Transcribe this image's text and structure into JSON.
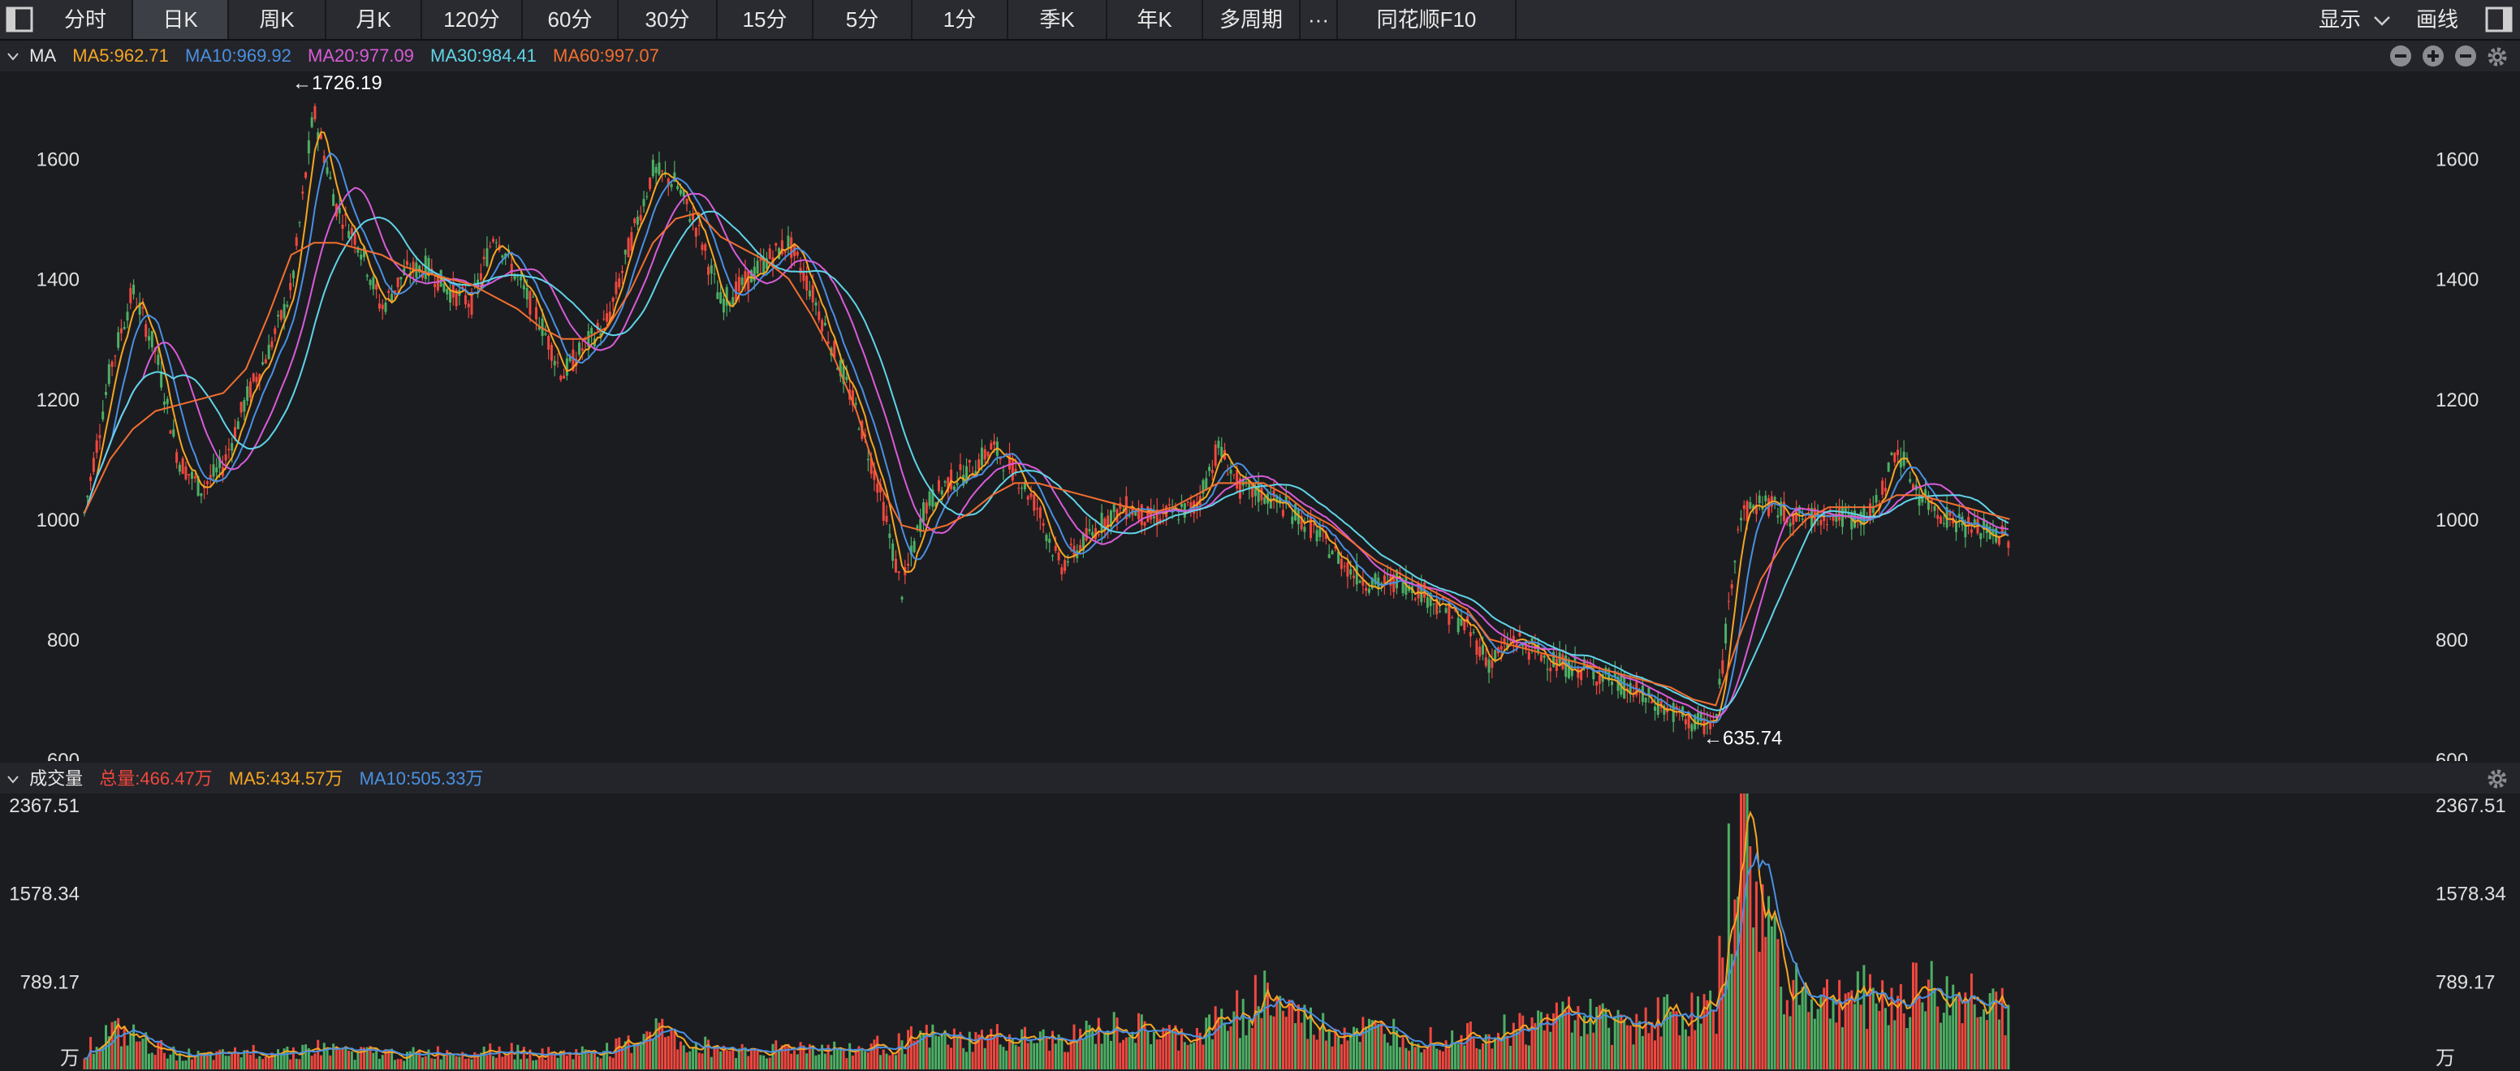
{
  "toolbar": {
    "tabs": [
      {
        "label": "分时"
      },
      {
        "label": "日K"
      },
      {
        "label": "周K"
      },
      {
        "label": "月K"
      },
      {
        "label": "120分"
      },
      {
        "label": "60分"
      },
      {
        "label": "30分"
      },
      {
        "label": "15分"
      },
      {
        "label": "5分"
      },
      {
        "label": "1分"
      },
      {
        "label": "季K"
      },
      {
        "label": "年K"
      },
      {
        "label": "多周期"
      },
      {
        "label": "···"
      },
      {
        "label": "同花顺F10"
      }
    ],
    "active_tab": "日K",
    "display_label": "显示",
    "draw_label": "画线"
  },
  "ma_legend": {
    "title": "MA",
    "ma5": "MA5:962.71",
    "ma10": "MA10:969.92",
    "ma20": "MA20:977.09",
    "ma30": "MA30:984.41",
    "ma60": "MA60:997.07"
  },
  "vol_legend": {
    "title": "成交量",
    "total": "总量:466.47万",
    "ma5": "MA5:434.57万",
    "ma10": "MA10:505.33万"
  },
  "colors": {
    "up": "#f0483e",
    "down": "#4caf64",
    "ma5": "#f5a623",
    "ma10": "#4a90e2",
    "ma20": "#d85cd8",
    "ma30": "#5fd4e8",
    "ma60": "#f26f30"
  },
  "chart_data": [
    {
      "type": "candlestick",
      "title": "",
      "y_ticks": [
        600,
        800,
        1000,
        1200,
        1400,
        1600
      ],
      "ylim": [
        600,
        1740
      ],
      "annotations": [
        {
          "label": "←1726.19",
          "value": 1726.19,
          "kind": "high"
        },
        {
          "label": "←635.74",
          "value": 635.74,
          "kind": "low"
        }
      ],
      "x": [
        0,
        16,
        30,
        44,
        58,
        72,
        86,
        100,
        114,
        128,
        142,
        156,
        170,
        184,
        198,
        212,
        226,
        240,
        254,
        268,
        282,
        296,
        310,
        324,
        338,
        352,
        366,
        380,
        394,
        408,
        422,
        436,
        450,
        464,
        478,
        492,
        506,
        520,
        534,
        548,
        562,
        576,
        590,
        604,
        618,
        632,
        646,
        660,
        674,
        688,
        702,
        716,
        730,
        744,
        758,
        772,
        786,
        800,
        814,
        828,
        842,
        856,
        870,
        884,
        898,
        912,
        926,
        940,
        954,
        968,
        982,
        996,
        1010,
        1024,
        1038,
        1052,
        1066,
        1080,
        1094,
        1108,
        1122,
        1136,
        1150,
        1164,
        1178,
        1192,
        1206,
        1220,
        1234,
        1248,
        1262,
        1276,
        1290,
        1304,
        1318,
        1332
      ],
      "close": [
        1010,
        1250,
        1380,
        1280,
        1100,
        1050,
        1090,
        1200,
        1280,
        1380,
        1680,
        1520,
        1460,
        1350,
        1410,
        1420,
        1380,
        1360,
        1480,
        1400,
        1330,
        1240,
        1290,
        1330,
        1460,
        1580,
        1560,
        1480,
        1360,
        1390,
        1430,
        1460,
        1380,
        1280,
        1180,
        1050,
        880,
        1020,
        1060,
        1080,
        1120,
        1080,
        1020,
        920,
        960,
        1000,
        1020,
        1000,
        1010,
        1020,
        1120,
        1050,
        1040,
        1020,
        990,
        950,
        910,
        890,
        900,
        880,
        850,
        820,
        760,
        800,
        780,
        760,
        750,
        740,
        720,
        700,
        680,
        660,
        660,
        1000,
        1030,
        1010,
        1000,
        1010,
        1000,
        1010,
        1120,
        1040,
        1010,
        990,
        980,
        970
      ],
      "ma60": [
        1010,
        1100,
        1150,
        1180,
        1190,
        1200,
        1210,
        1250,
        1340,
        1440,
        1460,
        1460,
        1450,
        1440,
        1420,
        1410,
        1400,
        1390,
        1370,
        1350,
        1320,
        1300,
        1300,
        1320,
        1380,
        1460,
        1500,
        1510,
        1470,
        1450,
        1430,
        1400,
        1340,
        1270,
        1180,
        1060,
        990,
        980,
        990,
        1010,
        1040,
        1060,
        1060,
        1050,
        1040,
        1030,
        1020,
        1010,
        1020,
        1040,
        1060,
        1060,
        1060,
        1040,
        1010,
        990,
        960,
        930,
        910,
        890,
        870,
        850,
        800,
        790,
        780,
        770,
        760,
        750,
        740,
        730,
        720,
        700,
        690,
        800,
        900,
        960,
        1000,
        1020,
        1020,
        1020,
        1040,
        1040,
        1030,
        1020,
        1010,
        1000
      ]
    },
    {
      "type": "bar",
      "title": "",
      "unit": "万",
      "y_ticks": [
        789.17,
        1578.34,
        2367.51
      ],
      "ylim": [
        0,
        2367.51
      ],
      "x": [
        0,
        16,
        30,
        44,
        58,
        72,
        86,
        100,
        114,
        128,
        142,
        156,
        170,
        184,
        198,
        212,
        226,
        240,
        254,
        268,
        282,
        296,
        310,
        324,
        338,
        352,
        366,
        380,
        394,
        408,
        422,
        436,
        450,
        464,
        478,
        492,
        506,
        520,
        534,
        548,
        562,
        576,
        590,
        604,
        618,
        632,
        646,
        660,
        674,
        688,
        702,
        716,
        730,
        744,
        758,
        772,
        786,
        800,
        814,
        828,
        842,
        856,
        870,
        884,
        898,
        912,
        926,
        940,
        954,
        968,
        982,
        996,
        1010,
        1024,
        1038,
        1052,
        1066,
        1080,
        1094,
        1108,
        1122,
        1136,
        1150,
        1164,
        1178,
        1192,
        1206,
        1220,
        1234,
        1248,
        1262,
        1276,
        1290,
        1304,
        1318,
        1332
      ],
      "values": [
        180,
        350,
        300,
        200,
        150,
        120,
        130,
        160,
        180,
        170,
        200,
        180,
        160,
        150,
        140,
        150,
        160,
        170,
        200,
        160,
        150,
        140,
        160,
        180,
        230,
        420,
        260,
        220,
        200,
        180,
        190,
        200,
        210,
        190,
        180,
        220,
        260,
        300,
        280,
        260,
        300,
        280,
        270,
        260,
        320,
        360,
        380,
        340,
        300,
        320,
        420,
        560,
        700,
        560,
        420,
        360,
        380,
        340,
        360,
        300,
        320,
        360,
        340,
        380,
        400,
        500,
        560,
        440,
        420,
        480,
        520,
        500,
        560,
        2360,
        1500,
        900,
        700,
        620,
        700,
        660,
        640,
        820,
        620,
        680,
        700,
        560
      ]
    }
  ]
}
